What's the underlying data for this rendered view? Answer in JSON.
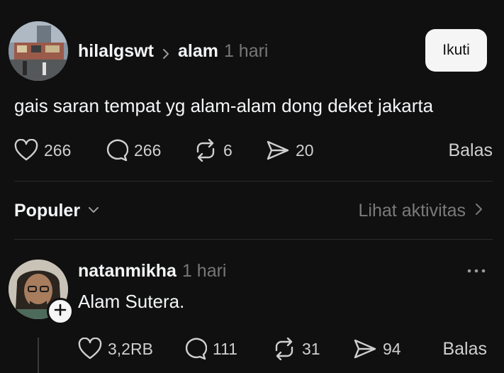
{
  "post": {
    "username": "hilalgswt",
    "topic": "alam",
    "time": "1 hari",
    "follow_label": "Ikuti",
    "text": "gais saran tempat yg alam-alam dong deket jakarta",
    "likes": "266",
    "comments": "266",
    "reposts": "6",
    "shares": "20",
    "reply_label": "Balas"
  },
  "sort": {
    "label": "Populer",
    "activity_label": "Lihat aktivitas"
  },
  "reply": {
    "username": "natanmikha",
    "time": "1 hari",
    "text": "Alam Sutera.",
    "likes": "3,2RB",
    "comments": "111",
    "reposts": "31",
    "shares": "94",
    "reply_label": "Balas"
  },
  "icons": {
    "like": "heart-icon",
    "comment": "comment-bubble-icon",
    "repost": "repost-icon",
    "share": "send-icon",
    "more": "more-icon",
    "follow_plus": "plus-icon"
  },
  "colors": {
    "background": "#101010",
    "text": "#f3f5f7",
    "muted": "#777777",
    "follow_button": "#f5f5f5"
  }
}
